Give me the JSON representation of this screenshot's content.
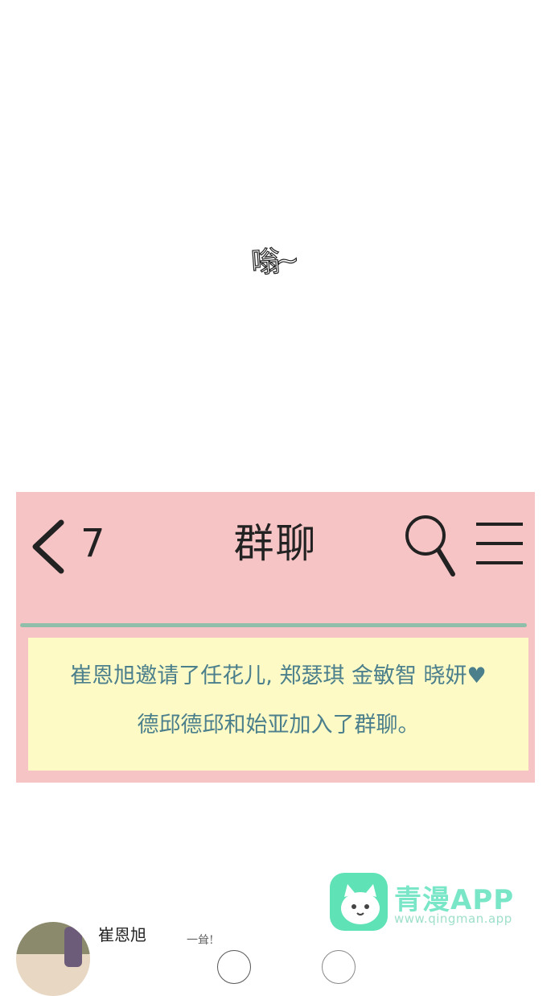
{
  "sound_effect": "嗡~",
  "header": {
    "back_count": "7",
    "title": "群聊"
  },
  "system_notice": {
    "line1": "崔恩旭邀请了任花儿, 郑瑟琪 金敏智 晓妍♥",
    "line2": "德邱德邱和始亚加入了群聊。"
  },
  "watermark": {
    "title": "青漫APP",
    "url": "www.qingman.app"
  },
  "message": {
    "sender": "崔恩旭",
    "sfx": "一耸!"
  },
  "colors": {
    "phone_bg": "#f7c4c6",
    "notice_bg": "#fdfac6",
    "notice_text": "#4b7f8c",
    "divider": "#8fbfaa",
    "watermark": "#5fe3b6"
  }
}
